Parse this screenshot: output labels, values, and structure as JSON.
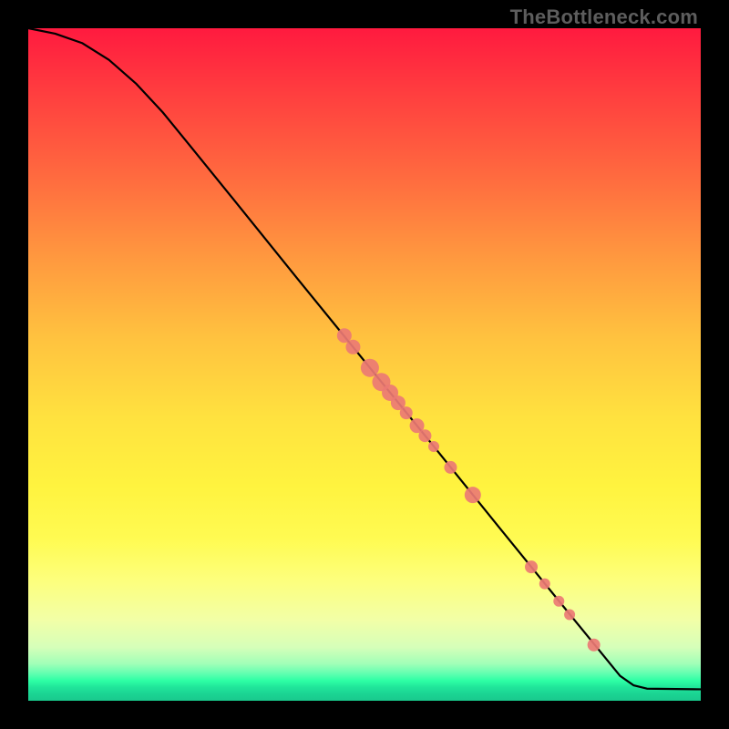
{
  "watermark": "TheBottleneck.com",
  "colors": {
    "point_fill": "#ec7a74",
    "curve_stroke": "#000000"
  },
  "chart_data": {
    "type": "line",
    "title": "",
    "xlabel": "",
    "ylabel": "",
    "xlim": [
      0,
      100
    ],
    "ylim": [
      0,
      100
    ],
    "curve": [
      {
        "x": 0,
        "y": 100
      },
      {
        "x": 4,
        "y": 99.2
      },
      {
        "x": 8,
        "y": 97.8
      },
      {
        "x": 12,
        "y": 95.3
      },
      {
        "x": 16,
        "y": 91.8
      },
      {
        "x": 20,
        "y": 87.5
      },
      {
        "x": 24,
        "y": 82.6
      },
      {
        "x": 30,
        "y": 75.2
      },
      {
        "x": 40,
        "y": 62.8
      },
      {
        "x": 50,
        "y": 50.5
      },
      {
        "x": 60,
        "y": 38.2
      },
      {
        "x": 70,
        "y": 25.8
      },
      {
        "x": 80,
        "y": 13.5
      },
      {
        "x": 88,
        "y": 3.7
      },
      {
        "x": 90,
        "y": 2.3
      },
      {
        "x": 92,
        "y": 1.8
      },
      {
        "x": 100,
        "y": 1.7
      }
    ],
    "points": [
      {
        "x": 47.0,
        "y": 54.3,
        "r": 8
      },
      {
        "x": 48.3,
        "y": 52.6,
        "r": 8
      },
      {
        "x": 50.8,
        "y": 49.5,
        "r": 10
      },
      {
        "x": 52.5,
        "y": 47.4,
        "r": 10
      },
      {
        "x": 53.8,
        "y": 45.8,
        "r": 9
      },
      {
        "x": 55.0,
        "y": 44.3,
        "r": 8
      },
      {
        "x": 56.2,
        "y": 42.8,
        "r": 7
      },
      {
        "x": 57.8,
        "y": 40.9,
        "r": 8
      },
      {
        "x": 59.0,
        "y": 39.4,
        "r": 7
      },
      {
        "x": 60.3,
        "y": 37.8,
        "r": 6
      },
      {
        "x": 62.8,
        "y": 34.7,
        "r": 7
      },
      {
        "x": 66.1,
        "y": 30.6,
        "r": 9
      },
      {
        "x": 74.8,
        "y": 19.9,
        "r": 7
      },
      {
        "x": 76.8,
        "y": 17.4,
        "r": 6
      },
      {
        "x": 78.9,
        "y": 14.8,
        "r": 6
      },
      {
        "x": 80.5,
        "y": 12.8,
        "r": 6
      },
      {
        "x": 84.1,
        "y": 8.3,
        "r": 7
      }
    ]
  }
}
